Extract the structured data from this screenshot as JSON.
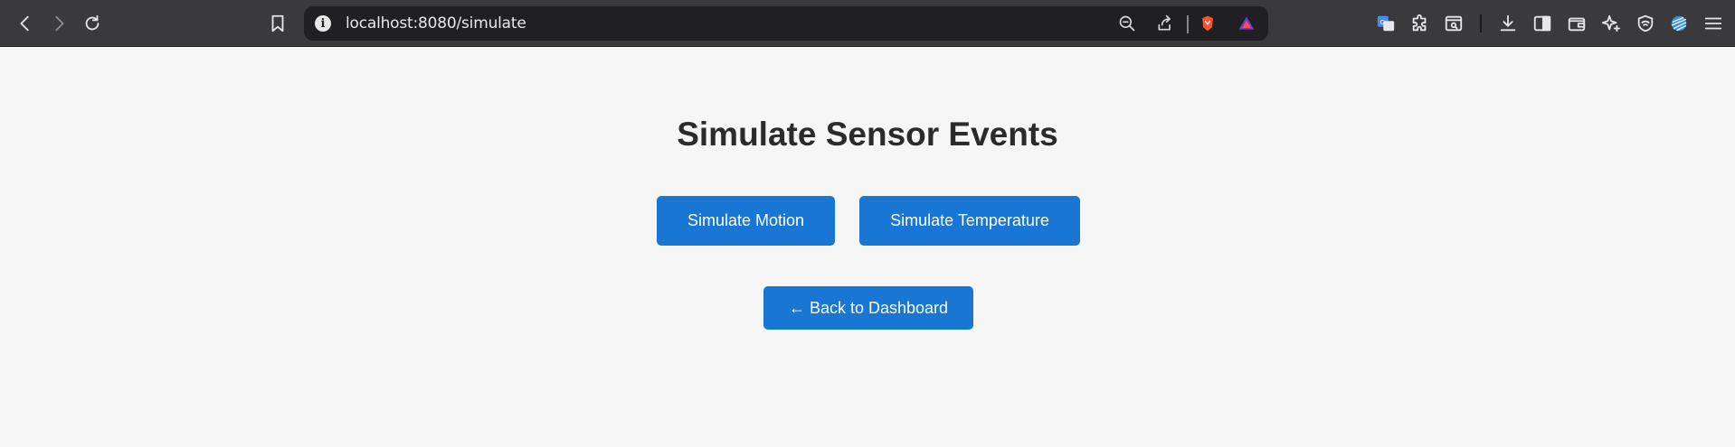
{
  "browser": {
    "url": "localhost:8080/simulate",
    "info_glyph": "i",
    "icons": {
      "nav": [
        "back-icon",
        "forward-icon",
        "reload-icon",
        "bookmark-icon"
      ],
      "urlbar": [
        "zoom-out-icon",
        "share-icon",
        "brave-shields-icon",
        "brave-rewards-icon"
      ],
      "toolbar": [
        "translate-icon",
        "extensions-icon",
        "tab-search-icon",
        "downloads-icon",
        "sidebar-icon",
        "wallet-icon",
        "leo-ai-icon",
        "vpn-icon",
        "stripes-extension-icon",
        "menu-icon"
      ]
    }
  },
  "page": {
    "title": "Simulate Sensor Events",
    "buttons": {
      "motion": "Simulate Motion",
      "temperature": "Simulate Temperature",
      "back": "← Back to Dashboard"
    }
  },
  "colors": {
    "primary_button": "#1976d2",
    "page_background": "#f6f6f6",
    "toolbar_background": "#3a3a3d",
    "urlbar_background": "#202023"
  }
}
